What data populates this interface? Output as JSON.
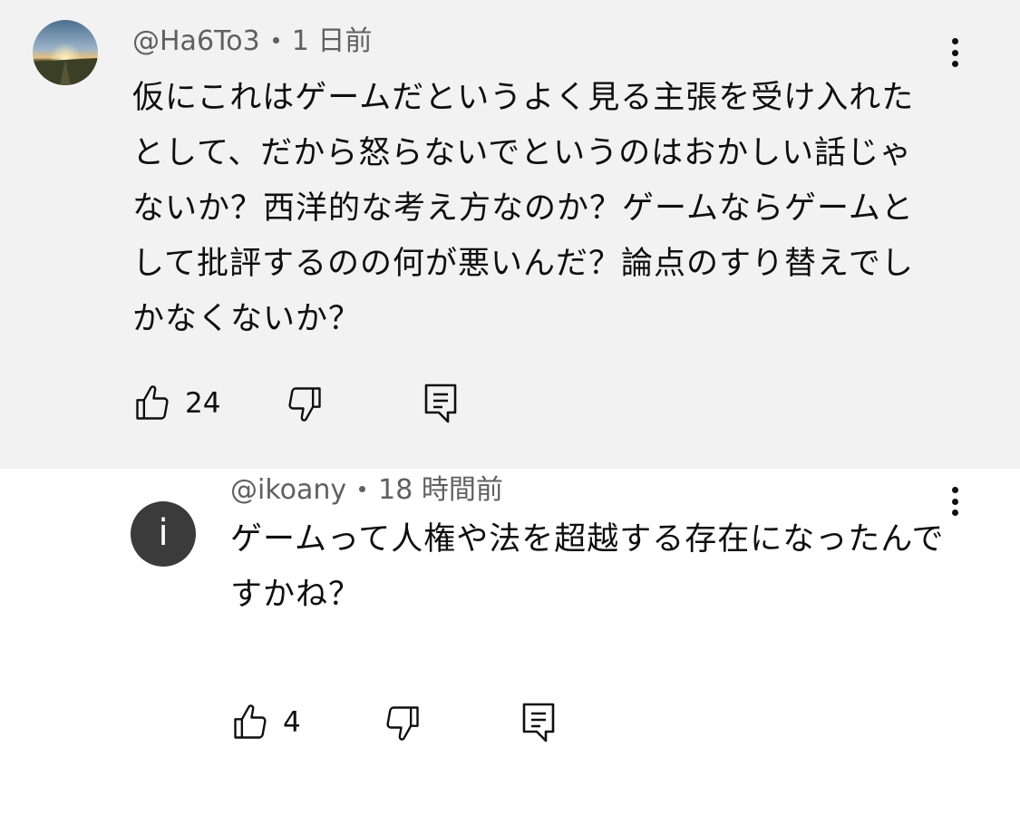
{
  "comments": [
    {
      "handle": "@Ha6To3",
      "time": "1 日前",
      "text": "仮にこれはゲームだというよく見る主張を受け入れたとして、だから怒らないでというのはおかしい話じゃないか？西洋的な考え方なのか？ゲームならゲームとして批評するのの何が悪いんだ？論点のすり替えでしかなくないか？",
      "likes": "24",
      "avatar": "landscape-sunset-avatar"
    },
    {
      "handle": "@ikoany",
      "time": "18 時間前",
      "text": "ゲームって人権や法を超越する存在になったんですかね？",
      "likes": "4",
      "avatar_letter": "i"
    }
  ],
  "icons": {
    "like": "thumbs-up-icon",
    "dislike": "thumbs-down-icon",
    "reply": "reply-comment-icon",
    "menu": "more-vertical-icon"
  },
  "colors": {
    "highlight_bg": "#f2f2f2",
    "meta_text": "#606060",
    "avatar_bg": "#3b3b3b"
  }
}
